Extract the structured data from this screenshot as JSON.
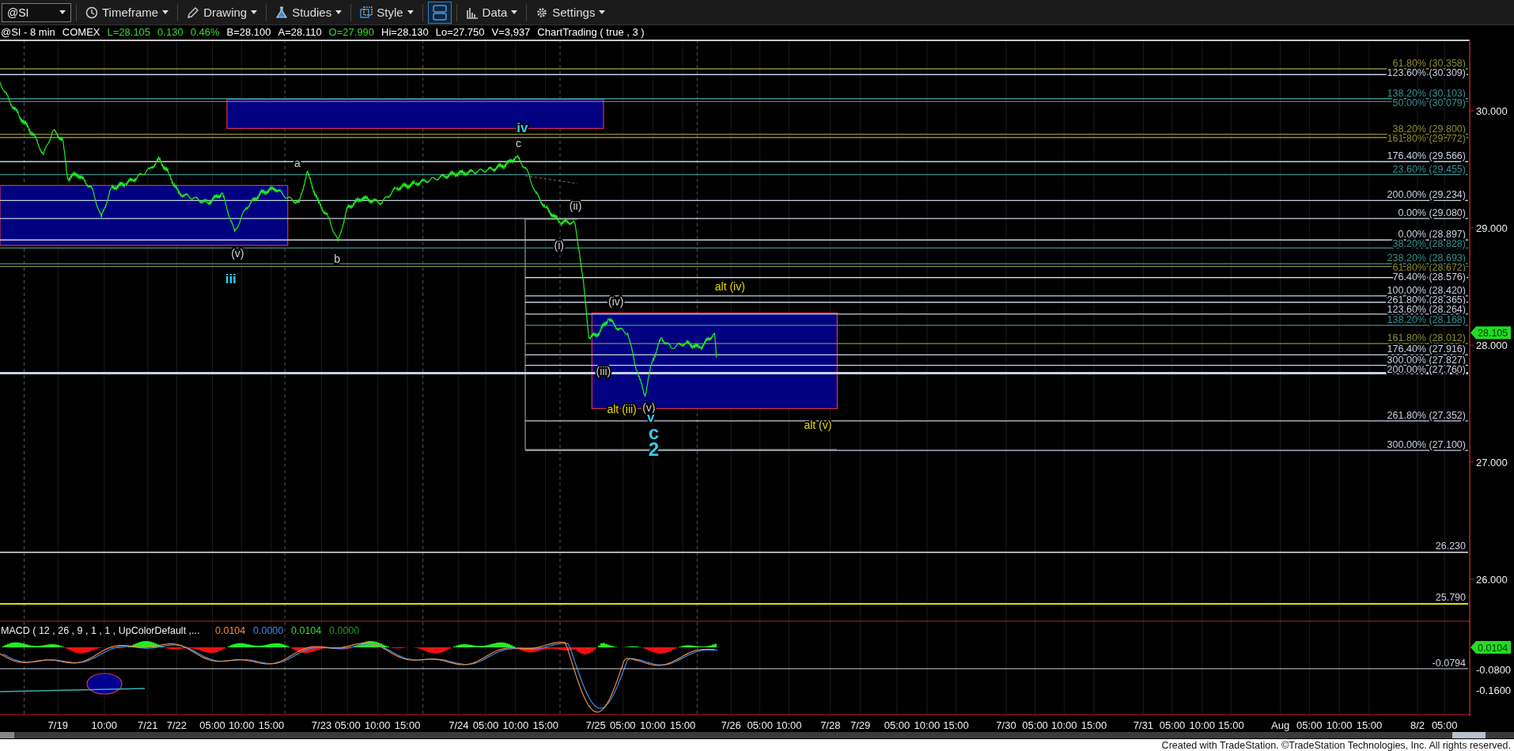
{
  "toolbar": {
    "symbol": "@SI",
    "items": [
      {
        "kind": "menu",
        "label": "Timeframe"
      },
      {
        "kind": "menu",
        "label": "Drawing"
      },
      {
        "kind": "menu",
        "label": "Studies"
      },
      {
        "kind": "menu",
        "label": "Style"
      },
      {
        "kind": "toggle",
        "selected": true
      },
      {
        "kind": "menu",
        "label": "Data"
      },
      {
        "kind": "menu",
        "label": "Settings"
      }
    ]
  },
  "info_line": [
    {
      "text": "@SI - 8 min",
      "color": "#ffffff"
    },
    {
      "text": "COMEX",
      "color": "#ffffff"
    },
    {
      "text": "L=28.105",
      "color": "#33dd33"
    },
    {
      "text": "0.130",
      "color": "#33dd33"
    },
    {
      "text": "0.46%",
      "color": "#33dd33"
    },
    {
      "text": "B=28.100",
      "color": "#ffffff"
    },
    {
      "text": "A=28.110",
      "color": "#ffffff"
    },
    {
      "text": "O=27.990",
      "color": "#33dd33"
    },
    {
      "text": "Hi=28.130",
      "color": "#ffffff"
    },
    {
      "text": "Lo=27.750",
      "color": "#ffffff"
    },
    {
      "text": "V=3,937",
      "color": "#ffffff"
    },
    {
      "text": "ChartTrading ( true , 3 )",
      "color": "#ffffff"
    }
  ],
  "price_axis": {
    "ticks": [
      "30.000",
      "29.000",
      "28.000",
      "27.000",
      "26.000"
    ],
    "last_price": "28.105"
  },
  "fib_levels": [
    {
      "label": "61.80% (30.358)",
      "color": "#8c8c32"
    },
    {
      "label": "123.60% (30.309)",
      "color": "#c8d0e0"
    },
    {
      "label": "138.20% (30.103)",
      "color": "#3a8f8f"
    },
    {
      "label": "50.00% (30.079)",
      "color": "#3a8f8f"
    },
    {
      "label": "38.20% (29.800)",
      "color": "#8c8c32"
    },
    {
      "label": "161.80% (29.772)",
      "color": "#8c8c32"
    },
    {
      "label": "176.40% (29.566)",
      "color": "#c8d0e0"
    },
    {
      "label": "23.60% (29.455)",
      "color": "#3a8f8f"
    },
    {
      "label": "200.00% (29.234)",
      "color": "#c8d0e0"
    },
    {
      "label": "0.00% (29.080)",
      "color": "#c8d0e0"
    },
    {
      "label": "0.00% (28.897)",
      "color": "#c8d0e0"
    },
    {
      "label": "38.20% (28.828)",
      "color": "#3a8f8f"
    },
    {
      "label": "238.20% (28.693)",
      "color": "#3a8f8f"
    },
    {
      "label": "61.80% (28.672)",
      "color": "#8c8c32"
    },
    {
      "label": "76.40% (28.576)",
      "color": "#c8d0e0"
    },
    {
      "label": "100.00% (28.420)",
      "color": "#c8d0e0"
    },
    {
      "label": "261.80% (28.365)",
      "color": "#c8d0e0"
    },
    {
      "label": "123.60% (28.264)",
      "color": "#c8d0e0"
    },
    {
      "label": "138.20% (28.168)",
      "color": "#3a8f8f"
    },
    {
      "label": "161.80% (28.012)",
      "color": "#8c8c32"
    },
    {
      "label": "176.40% (27.916)",
      "color": "#c8d0e0"
    },
    {
      "label": "300.00% (27.827)",
      "color": "#c8d0e0"
    },
    {
      "label": "200.00% (27.760)",
      "color": "#c8d0e0"
    },
    {
      "label": "261.80% (27.352)",
      "color": "#c8d0e0"
    },
    {
      "label": "300.00% (27.100)",
      "color": "#c8d0e0"
    }
  ],
  "levels": [
    {
      "label": "26.230",
      "color": "#b0b0b0"
    },
    {
      "label": "25.790",
      "color": "#e6e600"
    }
  ],
  "wave_labels": [
    {
      "text": "iv",
      "color": "#33ccee",
      "kind": "major"
    },
    {
      "text": "c",
      "color": "#d0d0d0",
      "kind": "minor"
    },
    {
      "text": "a",
      "color": "#d0d0d0",
      "kind": "minor"
    },
    {
      "text": "b",
      "color": "#d0d0d0",
      "kind": "minor"
    },
    {
      "text": "(v)",
      "color": "#d0d0d0",
      "kind": "minor"
    },
    {
      "text": "iii",
      "color": "#33ccee",
      "kind": "major"
    },
    {
      "text": "(ii)",
      "color": "#d0d0d0",
      "kind": "minor"
    },
    {
      "text": "(i)",
      "color": "#d0d0d0",
      "kind": "minor"
    },
    {
      "text": "(iv)",
      "color": "#d0d0d0",
      "kind": "minor"
    },
    {
      "text": "alt (iv)",
      "color": "#e6d800",
      "kind": "minor"
    },
    {
      "text": "(iii)",
      "color": "#d0d0d0",
      "kind": "minor"
    },
    {
      "text": "alt (iii)",
      "color": "#e6d800",
      "kind": "minor"
    },
    {
      "text": "(v)",
      "color": "#d0d0d0",
      "kind": "minor"
    },
    {
      "text": "v",
      "color": "#33ccee",
      "kind": "major"
    },
    {
      "text": "c",
      "color": "#33ccee",
      "kind": "primary"
    },
    {
      "text": "2",
      "color": "#33ccee",
      "kind": "primary"
    },
    {
      "text": "alt (v)",
      "color": "#e6d800",
      "kind": "minor"
    }
  ],
  "macd": {
    "title": "MACD ( 12 , 26 , 9 , 1 , 1 , UpColorDefault ,...",
    "values": [
      {
        "text": "0.0104",
        "color": "#f08a3c"
      },
      {
        "text": "0.0000",
        "color": "#3c8cf0"
      },
      {
        "text": "0.0104",
        "color": "#33dd33"
      },
      {
        "text": "0.0000",
        "color": "#2a9a2a"
      }
    ],
    "level_label": "-0.0794",
    "axis": [
      "-0.0800",
      "-0.1600"
    ],
    "last_value": "0.0104"
  },
  "time_axis": [
    "7/19",
    "10:00",
    "7/21",
    "7/22",
    "05:00",
    "10:00",
    "15:00",
    "7/23",
    "05:00",
    "10:00",
    "15:00",
    "7/24",
    "05:00",
    "10:00",
    "15:00",
    "7/25",
    "05:00",
    "10:00",
    "15:00",
    "7/26",
    "05:00",
    "10:00",
    "7/28",
    "7/29",
    "05:00",
    "10:00",
    "15:00",
    "7/30",
    "05:00",
    "10:00",
    "15:00",
    "7/31",
    "05:00",
    "10:00",
    "15:00",
    "Aug",
    "05:00",
    "10:00",
    "15:00",
    "8/2",
    "05:00"
  ],
  "footer": "Created with TradeStation. ©TradeStation Technologies, Inc. All rights reserved."
}
